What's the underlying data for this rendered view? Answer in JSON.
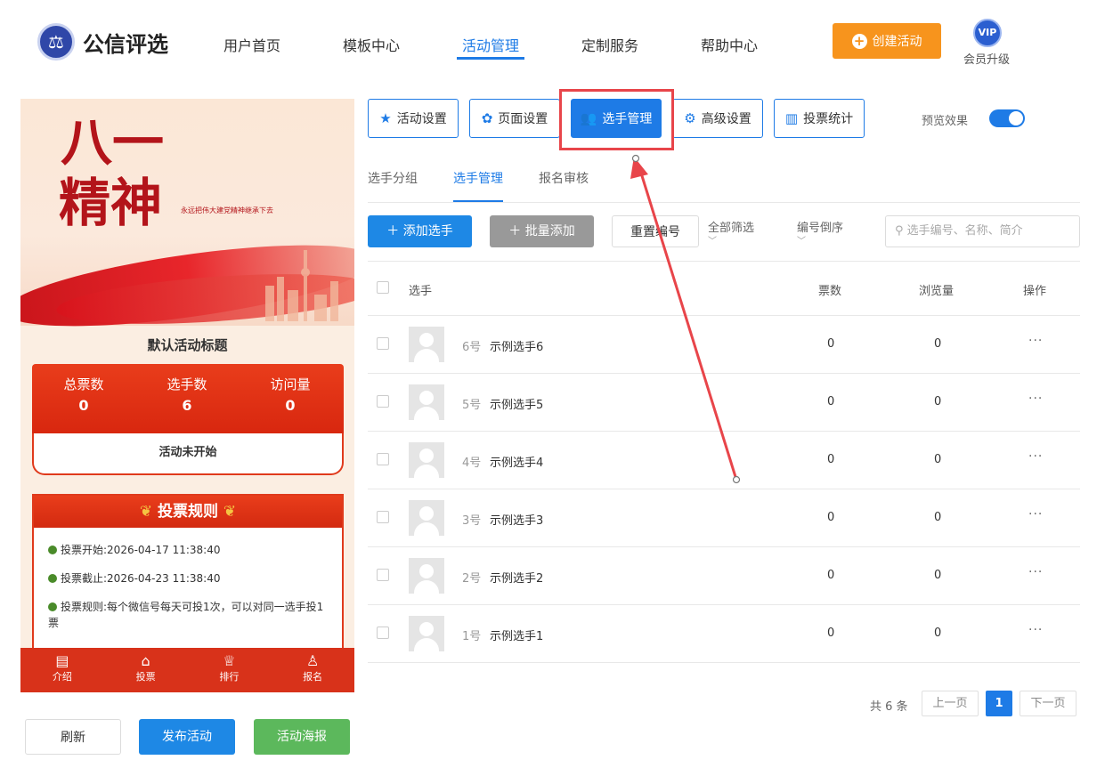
{
  "header": {
    "logo_text": "公信评选",
    "nav": [
      "用户首页",
      "模板中心",
      "活动管理",
      "定制服务",
      "帮助中心"
    ],
    "active_nav": "活动管理",
    "create_label": "创建活动",
    "vip_badge": "VIP",
    "vip_label": "会员升级",
    "colors": {
      "accent": "#1e7be6",
      "create": "#f7941d"
    }
  },
  "preview": {
    "banner_title": "八一精神",
    "banner_slogan": "永远把伟大建党精神继承下去",
    "activity_title": "默认活动标题",
    "stats": [
      {
        "label": "总票数",
        "value": "0"
      },
      {
        "label": "选手数",
        "value": "6"
      },
      {
        "label": "访问量",
        "value": "0"
      }
    ],
    "status": "活动未开始",
    "rules_title": "投票规则",
    "rules": [
      {
        "label": "投票开始:",
        "value": "2026-04-17 11:38:40"
      },
      {
        "label": "投票截止:",
        "value": "2026-04-23 11:38:40"
      },
      {
        "label": "投票规则:",
        "value": "每个微信号每天可投1次，可以对同一选手投1票"
      }
    ],
    "tabbar": [
      {
        "label": "介绍",
        "icon": "document-icon"
      },
      {
        "label": "投票",
        "icon": "home-icon"
      },
      {
        "label": "排行",
        "icon": "trophy-icon"
      },
      {
        "label": "报名",
        "icon": "user-add-icon"
      }
    ]
  },
  "bottom_buttons": {
    "refresh": "刷新",
    "publish": "发布活动",
    "poster": "活动海报"
  },
  "toolbar": {
    "tabs": [
      "活动设置",
      "页面设置",
      "选手管理",
      "高级设置",
      "投票统计"
    ],
    "active_tab": "选手管理",
    "preview_label": "预览效果",
    "preview_on": true
  },
  "subtabs": [
    "选手分组",
    "选手管理",
    "报名审核"
  ],
  "actions": {
    "add": "添加选手",
    "batch_add": "批量添加",
    "renumber": "重置编号",
    "filter_all": "全部筛选",
    "sort": "编号倒序",
    "search_placeholder": "选手编号、名称、简介"
  },
  "table": {
    "columns": [
      "选手",
      "票数",
      "浏览量",
      "操作"
    ],
    "rows": [
      {
        "num": "6号",
        "name": "示例选手6",
        "votes": "0",
        "views": "0"
      },
      {
        "num": "5号",
        "name": "示例选手5",
        "votes": "0",
        "views": "0"
      },
      {
        "num": "4号",
        "name": "示例选手4",
        "votes": "0",
        "views": "0"
      },
      {
        "num": "3号",
        "name": "示例选手3",
        "votes": "0",
        "views": "0"
      },
      {
        "num": "2号",
        "name": "示例选手2",
        "votes": "0",
        "views": "0"
      },
      {
        "num": "1号",
        "name": "示例选手1",
        "votes": "0",
        "views": "0"
      }
    ],
    "more": "···"
  },
  "pagination": {
    "total": "共 6 条",
    "prev": "上一页",
    "current": "1",
    "next": "下一页"
  }
}
